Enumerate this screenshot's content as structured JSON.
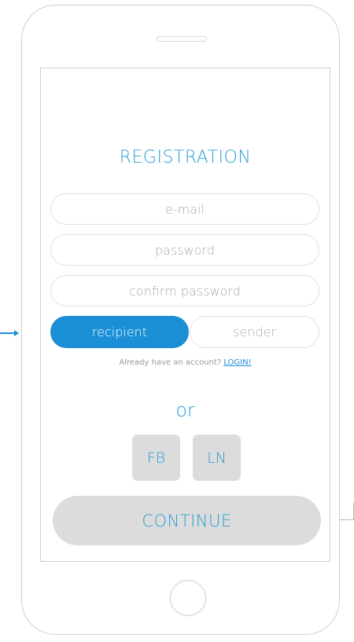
{
  "registration": {
    "title": "REGISTRATION",
    "email_placeholder": "e-mail",
    "password_placeholder": "password",
    "confirm_password_placeholder": "confirm password",
    "role_options": {
      "recipient_label": "recipient",
      "sender_label": "sender",
      "selected": "recipient"
    },
    "account_prompt": "Already have an account? ",
    "login_link": "LOGIN!",
    "or_label": "or",
    "social": {
      "facebook_label": "FB",
      "linkedin_label": "LN"
    },
    "continue_label": "CONTINUE"
  },
  "colors": {
    "accent": "#1a8fd6",
    "text_accent": "#2b9fd8",
    "button_gray": "#dcdcdc",
    "border_gray": "#e1e1e1",
    "placeholder_gray": "#a9a9a9"
  }
}
